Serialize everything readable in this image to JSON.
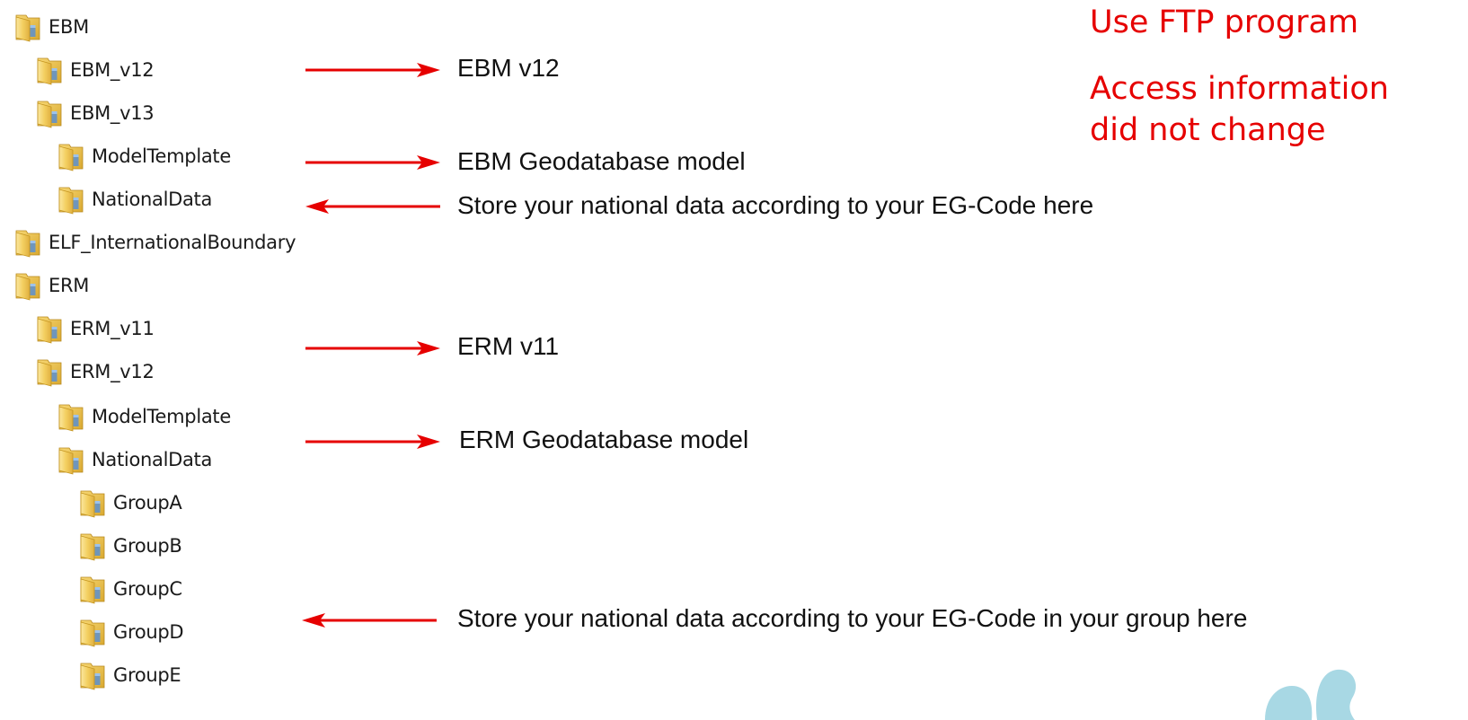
{
  "colors": {
    "annotation_red": "#e60000",
    "decoration_blue": "#a8d8e4"
  },
  "tree": {
    "icon": "folder-icon",
    "items": [
      {
        "label": "EBM"
      },
      {
        "label": "EBM_v12"
      },
      {
        "label": "EBM_v13"
      },
      {
        "label": "ModelTemplate"
      },
      {
        "label": "NationalData"
      },
      {
        "label": "ELF_InternationalBoundary"
      },
      {
        "label": "ERM"
      },
      {
        "label": "ERM_v11"
      },
      {
        "label": "ERM_v12"
      },
      {
        "label": "ModelTemplate"
      },
      {
        "label": "NationalData"
      },
      {
        "label": "GroupA"
      },
      {
        "label": "GroupB"
      },
      {
        "label": "GroupC"
      },
      {
        "label": "GroupD"
      },
      {
        "label": "GroupE"
      }
    ]
  },
  "annotations": [
    {
      "text": "EBM v12",
      "arrow": "right"
    },
    {
      "text": "EBM Geodatabase model",
      "arrow": "right"
    },
    {
      "text": "Store your national data according to your EG-Code here",
      "arrow": "left"
    },
    {
      "text": "ERM v11",
      "arrow": "right"
    },
    {
      "text": "ERM Geodatabase model",
      "arrow": "right"
    },
    {
      "text": "Store your national data according to your EG-Code in your group here",
      "arrow": "left"
    }
  ],
  "notes": {
    "line1": "Use FTP program",
    "line2": "Access information",
    "line3": "did not change"
  }
}
